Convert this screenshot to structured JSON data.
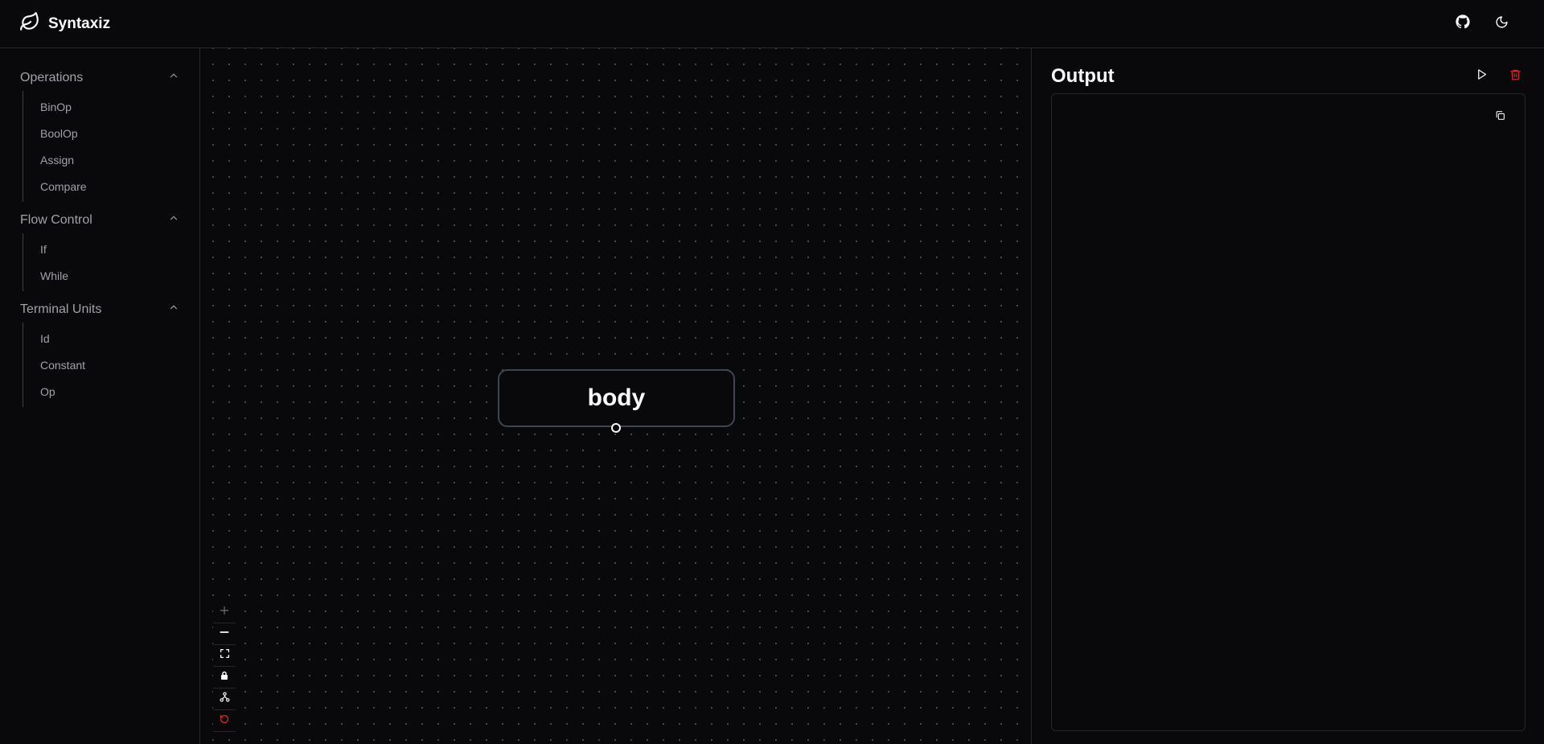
{
  "app": {
    "title": "Syntaxiz",
    "icons": {
      "logo": "leaf-icon",
      "github": "github-icon",
      "theme": "moon-icon"
    }
  },
  "sidebar": {
    "sections": [
      {
        "title": "Operations",
        "icon": "chevron-up-icon",
        "items": [
          "BinOp",
          "BoolOp",
          "Assign",
          "Compare"
        ]
      },
      {
        "title": "Flow Control",
        "icon": "chevron-up-icon",
        "items": [
          "If",
          "While"
        ]
      },
      {
        "title": "Terminal Units",
        "icon": "chevron-up-icon",
        "items": [
          "Id",
          "Constant",
          "Op"
        ]
      }
    ]
  },
  "canvas": {
    "node": {
      "label": "body"
    },
    "controls": [
      "zoom-in-icon",
      "zoom-out-icon",
      "fit-view-icon",
      "lock-icon",
      "layout-tree-icon",
      "reset-icon"
    ]
  },
  "output": {
    "title": "Output",
    "content": "",
    "icons": {
      "run": "play-icon",
      "clear": "trash-icon",
      "copy": "copy-icon"
    }
  },
  "colors": {
    "background": "#09090b",
    "border": "#27272a",
    "text": "#fafafa",
    "muted": "#a1a1aa",
    "danger": "#dc2626"
  }
}
